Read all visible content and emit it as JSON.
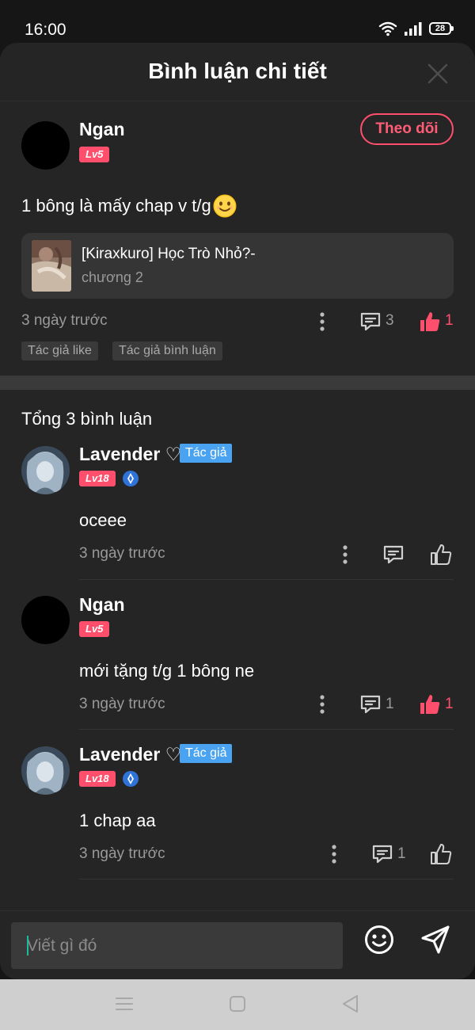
{
  "status_bar": {
    "time": "16:00",
    "battery": "28"
  },
  "header": {
    "title": "Bình luận chi tiết"
  },
  "main_comment": {
    "username": "Ngan",
    "level": "Lv5",
    "follow_label": "Theo dõi",
    "text": "1 bông là mấy chap v t/g",
    "chapter": {
      "title": "[Kiraxkuro] Học Trò Nhỏ?-",
      "subtitle": "chương 2"
    },
    "time": "3 ngày trước",
    "reply_count": "3",
    "like_count": "1",
    "chips": [
      "Tác giả like",
      "Tác giả bình luận"
    ]
  },
  "total_label": "Tổng 3 bình luận",
  "replies": [
    {
      "username": "Lavender ♡",
      "author_tag": "Tác giả",
      "level": "Lv18",
      "text": "oceee",
      "time": "3 ngày trước",
      "reply_count": "",
      "like_count": ""
    },
    {
      "username": "Ngan",
      "level": "Lv5",
      "text": "mới tặng t/g 1 bông ne",
      "time": "3 ngày trước",
      "reply_count": "1",
      "like_count": "1"
    },
    {
      "username": "Lavender ♡",
      "author_tag": "Tác giả",
      "level": "Lv18",
      "text": "1 chap aa",
      "time": "3 ngày trước",
      "reply_count": "1",
      "like_count": ""
    }
  ],
  "input": {
    "placeholder": "Viết gì đó"
  },
  "colors": {
    "accent": "#ff4f6d",
    "author_tag": "#4aa3f0",
    "sheet_bg": "#252525"
  },
  "icons": [
    "wifi-icon",
    "signal-icon",
    "battery-icon",
    "close-icon",
    "smile-emoji-icon",
    "more-icon",
    "reply-icon",
    "like-icon",
    "shield-icon",
    "emoji-button-icon",
    "send-icon",
    "menu-icon",
    "home-icon",
    "back-icon"
  ]
}
